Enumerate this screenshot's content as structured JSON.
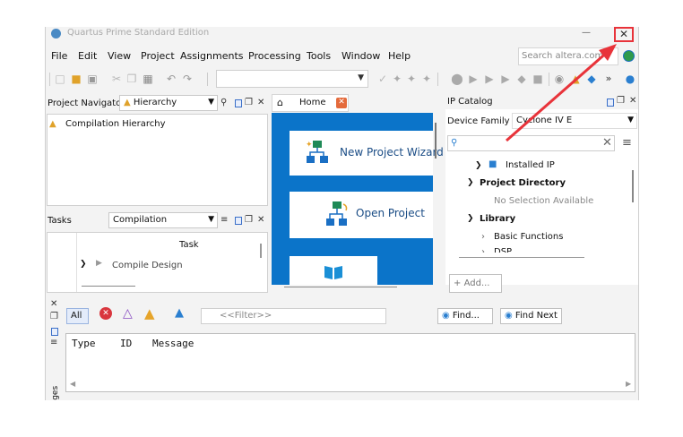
{
  "window": {
    "title": "Quartus Prime Standard Edition",
    "minimize_glyph": "—",
    "close_glyph": "✕"
  },
  "menu": {
    "items": [
      "File",
      "Edit",
      "View",
      "Project",
      "Assignments",
      "Processing",
      "Tools",
      "Window",
      "Help"
    ]
  },
  "search": {
    "placeholder": "Search altera.com"
  },
  "project_navigator": {
    "label": "Project Navigator",
    "view": "Hierarchy",
    "root": "Compilation Hierarchy"
  },
  "tasks": {
    "label": "Tasks",
    "flow": "Compilation",
    "column": "Task",
    "item": "Compile Design"
  },
  "home": {
    "tab": "Home",
    "cards": [
      "New Project Wizard",
      "Open Project"
    ]
  },
  "ip_catalog": {
    "title": "IP Catalog",
    "device_family_label": "Device Family",
    "device_family": "Cyclone IV E",
    "tree": {
      "installed": "Installed IP",
      "project_directory": "Project Directory",
      "no_selection": "No Selection Available",
      "library": "Library",
      "basic_functions": "Basic Functions",
      "dsp": "DSP"
    },
    "add_button": "Add..."
  },
  "messages": {
    "all": "All",
    "filter_placeholder": "<<Filter>>",
    "find": "Find...",
    "find_next": "Find Next",
    "columns": {
      "type": "Type",
      "id": "ID",
      "message": "Message"
    },
    "side_tab": "Messages"
  },
  "colors": {
    "home_blue": "#0b74c9",
    "annotation_red": "#e8333a",
    "accent_orange": "#e46a3b"
  }
}
